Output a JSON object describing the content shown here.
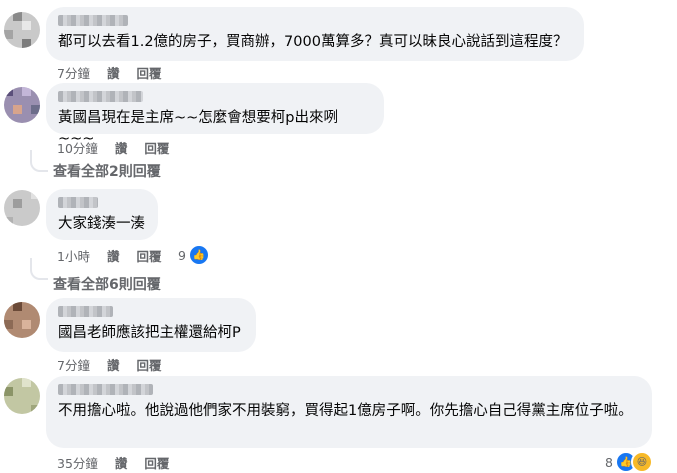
{
  "comments": [
    {
      "text": "都可以去看1.2億的房子，買商辦，7000萬算多？真可以昧良心說話到這程度？",
      "time": "7分鐘",
      "like": "讚",
      "reply": "回覆"
    },
    {
      "text": "黃國昌現在是主席~~怎麼會想要柯p出來咧~~~",
      "time": "10分鐘",
      "like": "讚",
      "reply": "回覆",
      "view_replies": "查看全部2則回覆"
    },
    {
      "text": "大家錢湊一湊",
      "time": "1小時",
      "like": "讚",
      "reply": "回覆",
      "reaction_count": "9",
      "view_replies": "查看全部6則回覆"
    },
    {
      "text": "國昌老師應該把主權還給柯P",
      "time": "7分鐘",
      "like": "讚",
      "reply": "回覆"
    },
    {
      "text": "不用擔心啦。他說過他們家不用裝窮，買得起1億房子啊。你先擔心自己得黨主席位子啦。",
      "time": "35分鐘",
      "like": "讚",
      "reply": "回覆",
      "reaction_count": "8"
    }
  ],
  "icons": {
    "like": "like-icon",
    "haha": "haha-icon"
  },
  "colors": {
    "bubble": "#f0f2f5",
    "meta": "#65676b",
    "like_blue": "#1877f2",
    "haha_yellow": "#f7b928"
  }
}
